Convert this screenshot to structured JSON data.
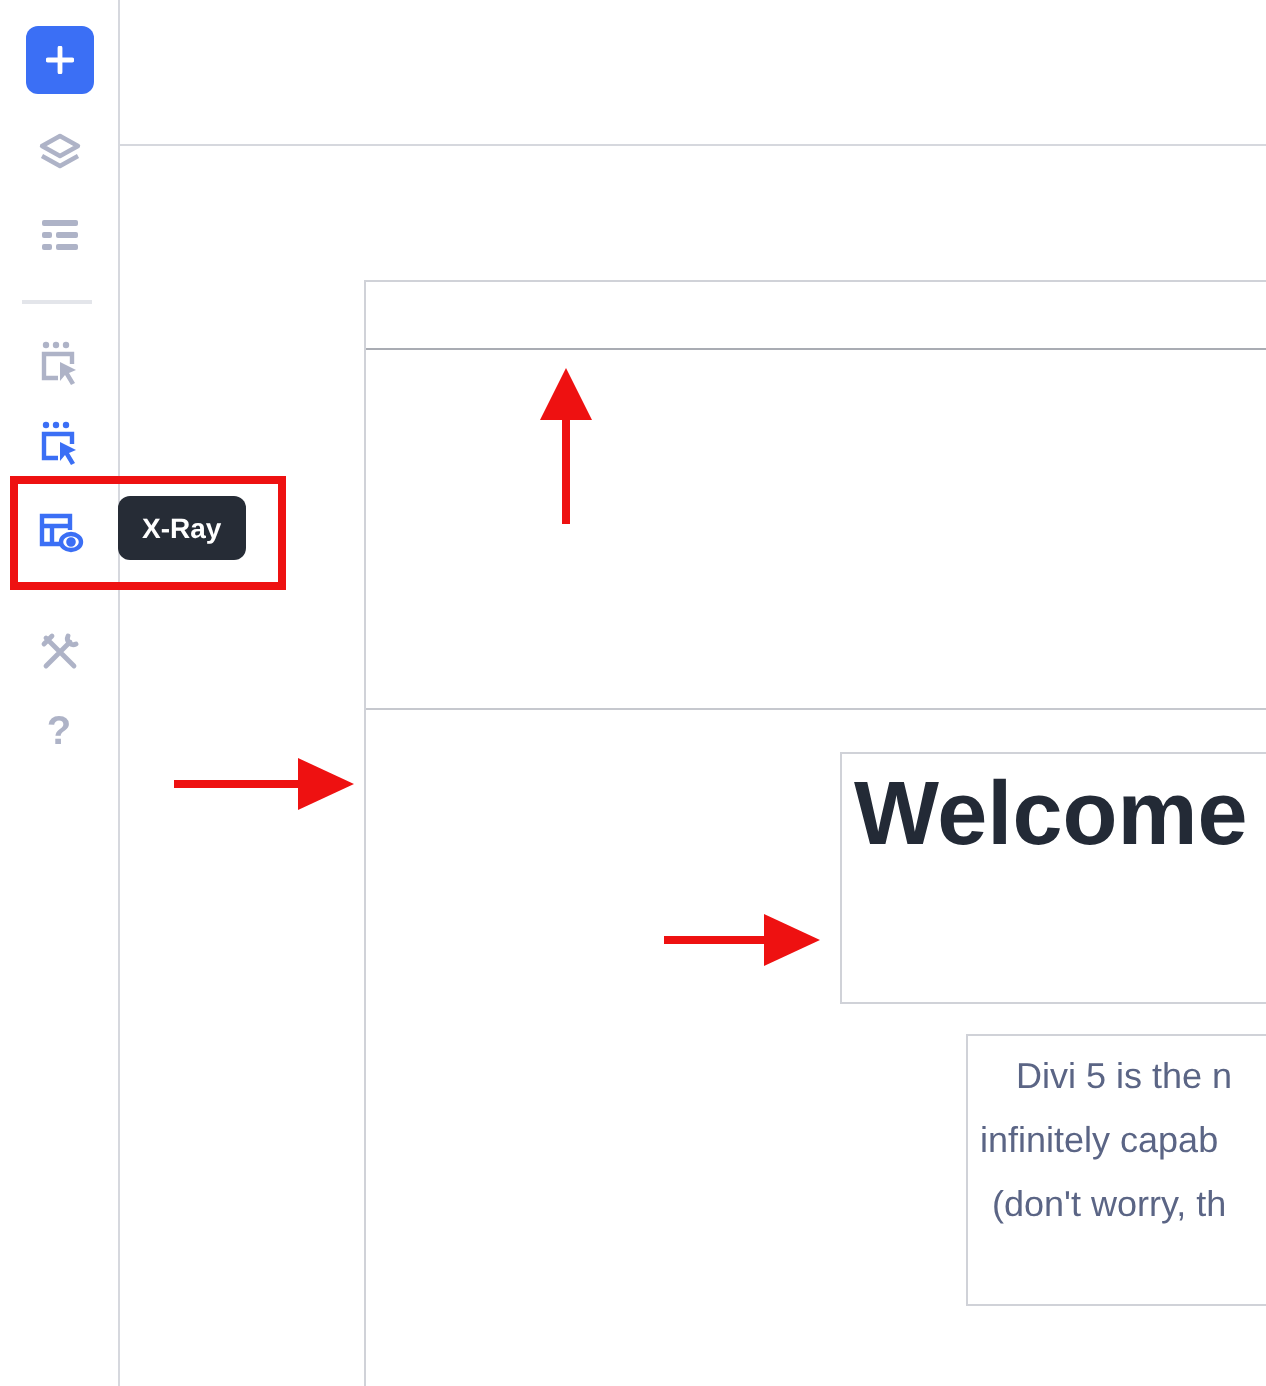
{
  "sidebar": {
    "items": [
      {
        "kind": "add",
        "active": true
      },
      {
        "kind": "layers",
        "active": false
      },
      {
        "kind": "bars",
        "active": false
      },
      {
        "kind": "divider"
      },
      {
        "kind": "select",
        "active": false
      },
      {
        "kind": "select",
        "active": true
      },
      {
        "kind": "xray",
        "active": true
      },
      {
        "kind": "tools",
        "active": false
      },
      {
        "kind": "help",
        "label": "?",
        "active": false
      }
    ]
  },
  "tooltip": {
    "label": "X-Ray"
  },
  "canvas": {
    "heading": "Welcome",
    "paragraph_lines": [
      "Divi 5 is the n",
      "infinitely capab",
      "(don't worry, th"
    ]
  }
}
